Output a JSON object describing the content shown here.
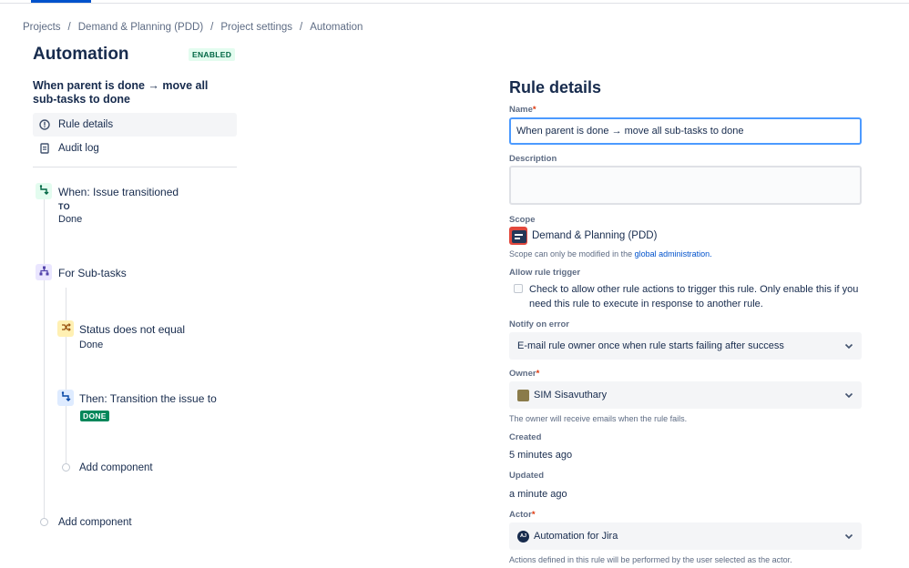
{
  "breadcrumb": {
    "items": [
      "Projects",
      "Demand & Planning (PDD)",
      "Project settings",
      "Automation"
    ],
    "separator": "/"
  },
  "page": {
    "title": "Automation",
    "status_badge": "ENABLED",
    "rule_name": "When parent is done → move all sub-tasks to done"
  },
  "nav": {
    "rule_details": "Rule details",
    "audit_log": "Audit log"
  },
  "flow": {
    "trigger_title": "When: Issue transitioned",
    "trigger_to": "TO",
    "trigger_value": "Done",
    "branch_title": "For Sub-tasks",
    "condition_title": "Status does not equal",
    "condition_value": "Done",
    "action_title": "Then: Transition the issue to",
    "action_lozenge": "DONE",
    "inner_add": "Add component",
    "outer_add": "Add component"
  },
  "details": {
    "title": "Rule details",
    "name_label": "Name",
    "name_value": "When parent is done → move all sub-tasks to done",
    "description_label": "Description",
    "scope_label": "Scope",
    "scope_value": "Demand & Planning (PDD)",
    "scope_help": "Scope can only be modified in the",
    "scope_help_link": "global administration.",
    "allow_trigger_label": "Allow rule trigger",
    "allow_trigger_text": "Check to allow other rule actions to trigger this rule. Only enable this if you need this rule to execute in response to another rule.",
    "notify_label": "Notify on error",
    "notify_value": "E-mail rule owner once when rule starts failing after success",
    "owner_label": "Owner",
    "owner_value": "SIM Sisavuthary",
    "owner_help": "The owner will receive emails when the rule fails.",
    "created_label": "Created",
    "created_value": "5 minutes ago",
    "updated_label": "Updated",
    "updated_value": "a minute ago",
    "actor_label": "Actor",
    "actor_avatar_text": "AJ",
    "actor_value": "Automation for Jira",
    "actor_help": "Actions defined in this rule will be performed by the user selected as the actor.",
    "required_mark": "*"
  },
  "colors": {
    "accent": "#0052cc",
    "enabled_bg": "#e3fcef",
    "enabled_fg": "#006644",
    "done_lozenge": "#00875a",
    "focus_border": "#4c9aff"
  },
  "icons": [
    "info-icon",
    "audit-log-icon",
    "trigger-icon",
    "branch-icon",
    "condition-icon",
    "action-icon",
    "chevron-down-icon"
  ]
}
